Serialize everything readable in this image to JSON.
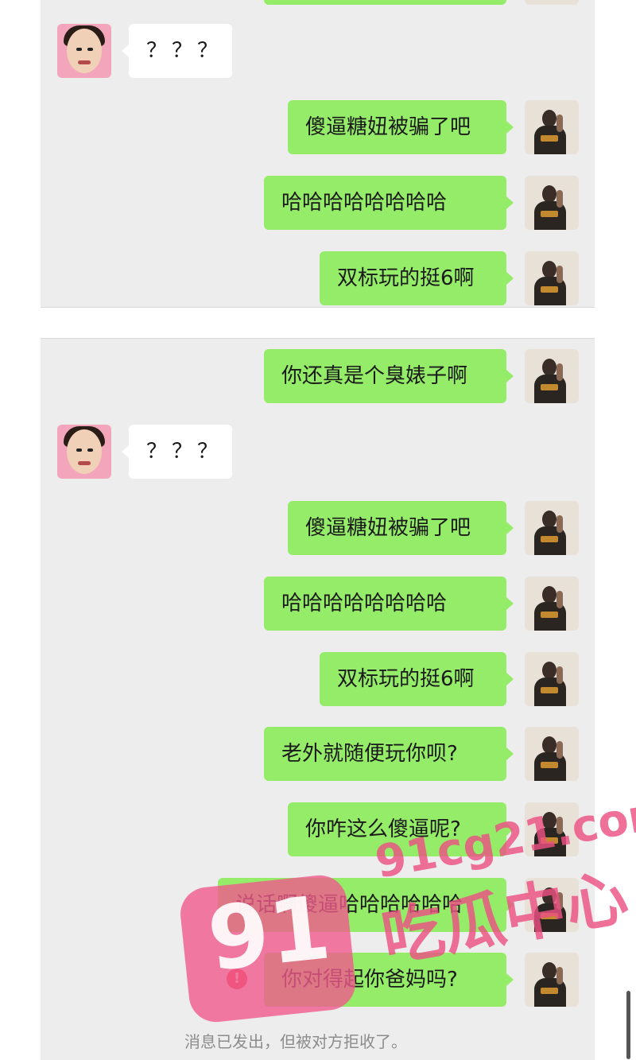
{
  "chat_top": {
    "incoming": "？？？",
    "outgoing": [
      "傻逼糖妞被骗了吧",
      "哈哈哈哈哈哈哈哈",
      "双标玩的挺6啊"
    ]
  },
  "chat_bottom": {
    "outgoing_first": "你还真是个臭婊子啊",
    "incoming": "？？？",
    "outgoing": [
      "傻逼糖妞被骗了吧",
      "哈哈哈哈哈哈哈哈",
      "双标玩的挺6啊",
      "老外就随便玩你呗?",
      "你咋这么傻逼呢?",
      "说话啊傻逼哈哈哈哈哈哈",
      "你对得起你爸妈吗?"
    ],
    "system_note": "消息已发出，但被对方拒收了。",
    "rejected_icon": "!"
  },
  "watermark": {
    "badge_number": "91",
    "site": "91cg21.com",
    "title": "吃瓜中心"
  },
  "colors": {
    "outgoing_bubble": "#95ec69",
    "incoming_bubble": "#ffffff",
    "chat_background": "#ededed",
    "rejected_icon": "#e8434a"
  }
}
